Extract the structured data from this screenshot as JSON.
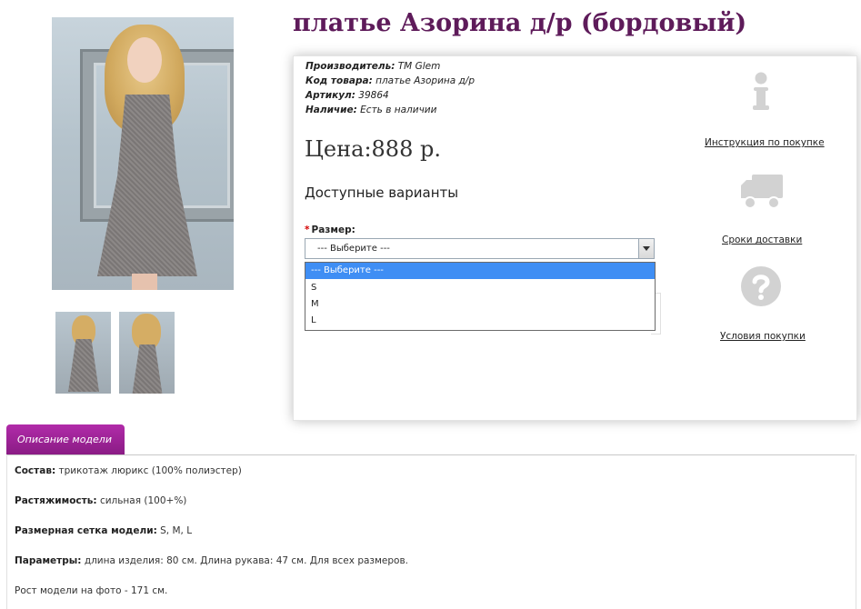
{
  "product": {
    "title": "платье Азорина д/р (бордовый)",
    "meta": [
      {
        "label": "Производитель:",
        "value": "TM Glem"
      },
      {
        "label": "Код товара:",
        "value": "платье Азорина д/р"
      },
      {
        "label": "Артикул:",
        "value": "39864"
      },
      {
        "label": "Наличие:",
        "value": "Есть в наличии"
      }
    ],
    "price": "Цена:888 р.",
    "variants_heading": "Доступные варианты",
    "size": {
      "required_mark": "*",
      "label": "Размер:",
      "selected": "--- Выберите ---",
      "options": [
        "--- Выберите ---",
        "S",
        "M",
        "L"
      ]
    }
  },
  "help": [
    {
      "icon": "info-icon",
      "label": "Инструкция по покупке"
    },
    {
      "icon": "delivery-truck-icon",
      "label": "Сроки доставки"
    },
    {
      "icon": "question-icon",
      "label": "Условия покупки"
    }
  ],
  "tab": {
    "label": "Описание модели"
  },
  "description": [
    {
      "label": "Состав:",
      "value": "трикотаж люрикс (100% полиэстер)"
    },
    {
      "label": "Растяжимость:",
      "value": "сильная (100+%)"
    },
    {
      "label": "Размерная сетка модели:",
      "value": "S, M, L"
    },
    {
      "label": "Параметры:",
      "value": "длина изделия: 80 см. Длина рукава: 47 см. Для всех размеров."
    },
    {
      "label": "",
      "value": "Рост модели на фото - 171 см."
    }
  ],
  "colors": {
    "title": "#5e1b5a",
    "tab": "#9b2196",
    "selected_option": "#3f8ef4"
  }
}
